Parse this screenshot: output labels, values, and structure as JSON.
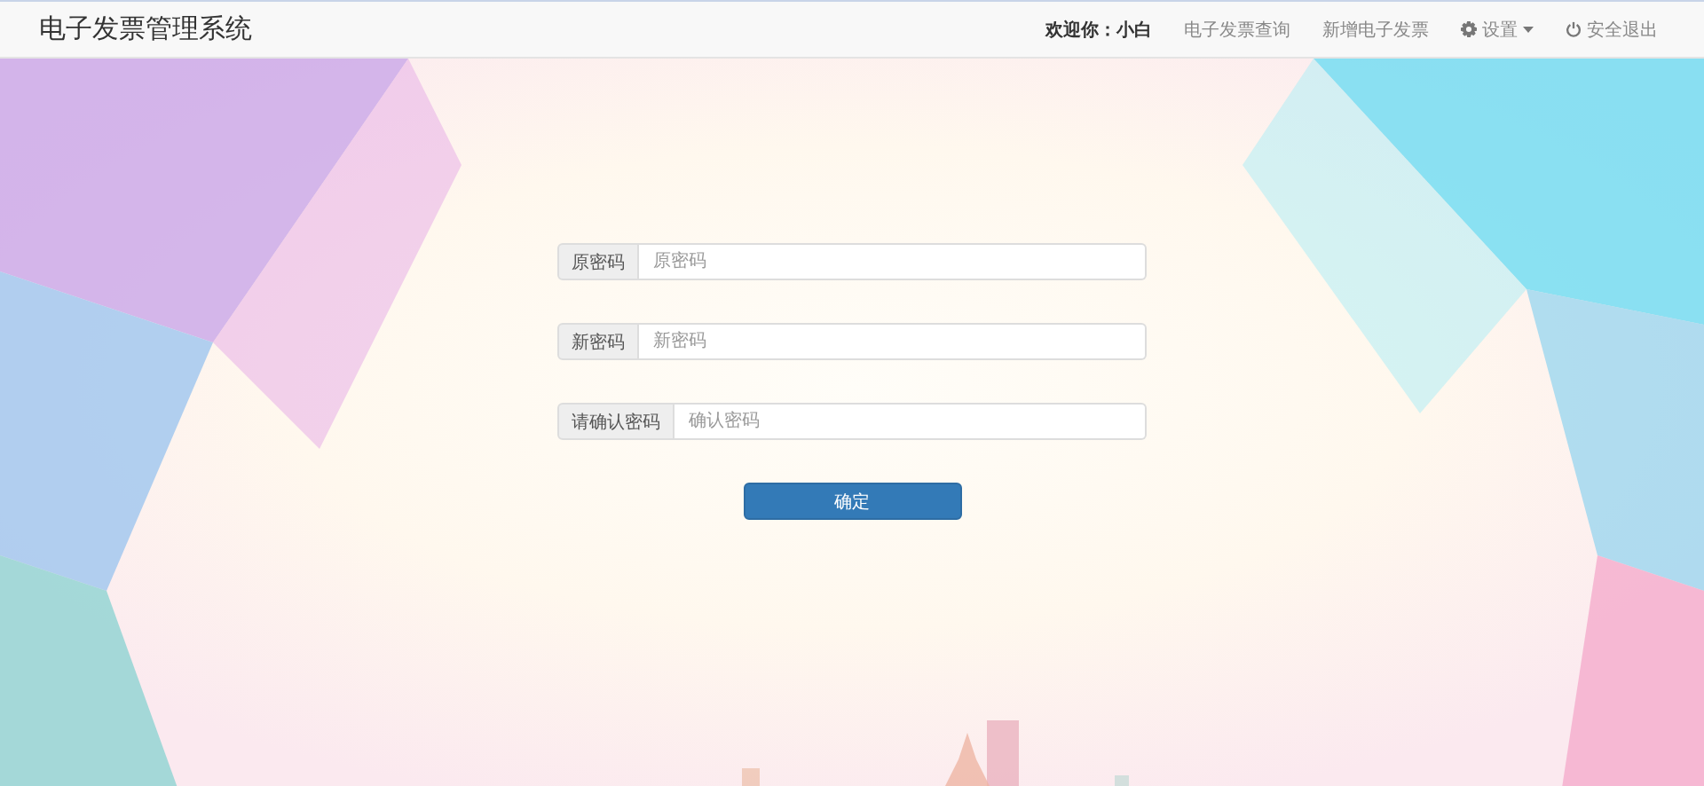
{
  "navbar": {
    "title": "电子发票管理系统",
    "welcome": "欢迎你：",
    "user": "小白",
    "links": [
      {
        "label": "电子发票查询",
        "kind": "link"
      },
      {
        "label": "新增电子发票",
        "kind": "link"
      },
      {
        "label": "设置",
        "kind": "dropdown"
      },
      {
        "label": "安全退出",
        "kind": "logout"
      }
    ]
  },
  "form": {
    "fields": [
      {
        "label": "原密码",
        "placeholder": "原密码"
      },
      {
        "label": "新密码",
        "placeholder": "新密码"
      },
      {
        "label": "请确认密码",
        "placeholder": "确认密码"
      }
    ],
    "submit": "确定"
  }
}
